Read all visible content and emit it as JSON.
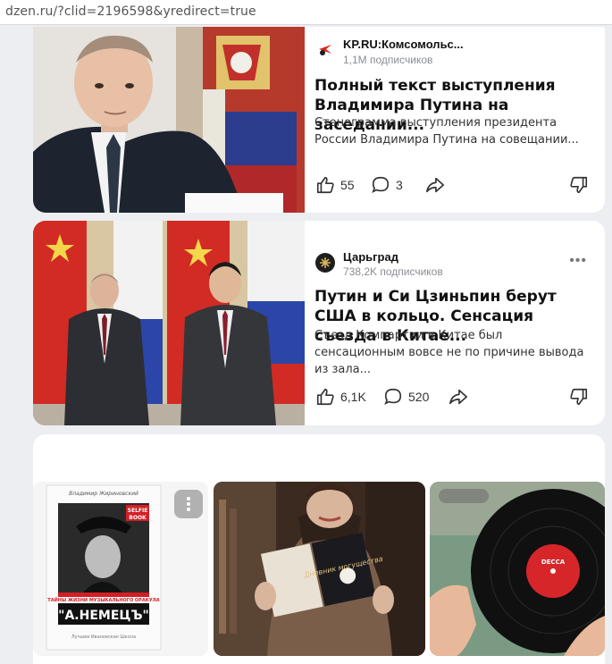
{
  "browser": {
    "url": "dzen.ru/?clid=2196598&yredirect=true"
  },
  "feed": {
    "cards": [
      {
        "source": "KP.RU:Комсомольс...",
        "subscribers": "1,1M подписчиков",
        "title": "Полный текст выступления Владимира Путина на заседании...",
        "description": "Стенограмма выступления президента России Владимира Путина на совещании...",
        "likes": "55",
        "comments": "3"
      },
      {
        "source": "Царьград",
        "subscribers": "738,2K подписчиков",
        "title": "Путин и Си Цзиньпин берут США в кольцо. Сенсация съезда в Китае...",
        "description": "Съезд Компартии в Китае был сенсационным вовсе не по причине вывода из зала...",
        "likes": "6,1K",
        "comments": "520"
      }
    ],
    "gallery": {
      "book": {
        "author": "Владимир Жириновский",
        "badge_top": "SELFIE",
        "badge_bottom": "BOOK",
        "tagline": "ТАЙНЫ ЖИЗНИ МУЗЫКАЛЬНОГО ОРАКУЛА",
        "name": "\"А.НЕМЕЦЪ\"",
        "footer": "Лучшее Ивановская Школа"
      },
      "book2_title": "Дневник могущества",
      "record_label": "DECCA"
    }
  },
  "colors": {
    "accent": "#ff3b3b",
    "muted": "#8a8d93",
    "card": "#ffffff",
    "page": "#eceef2"
  }
}
